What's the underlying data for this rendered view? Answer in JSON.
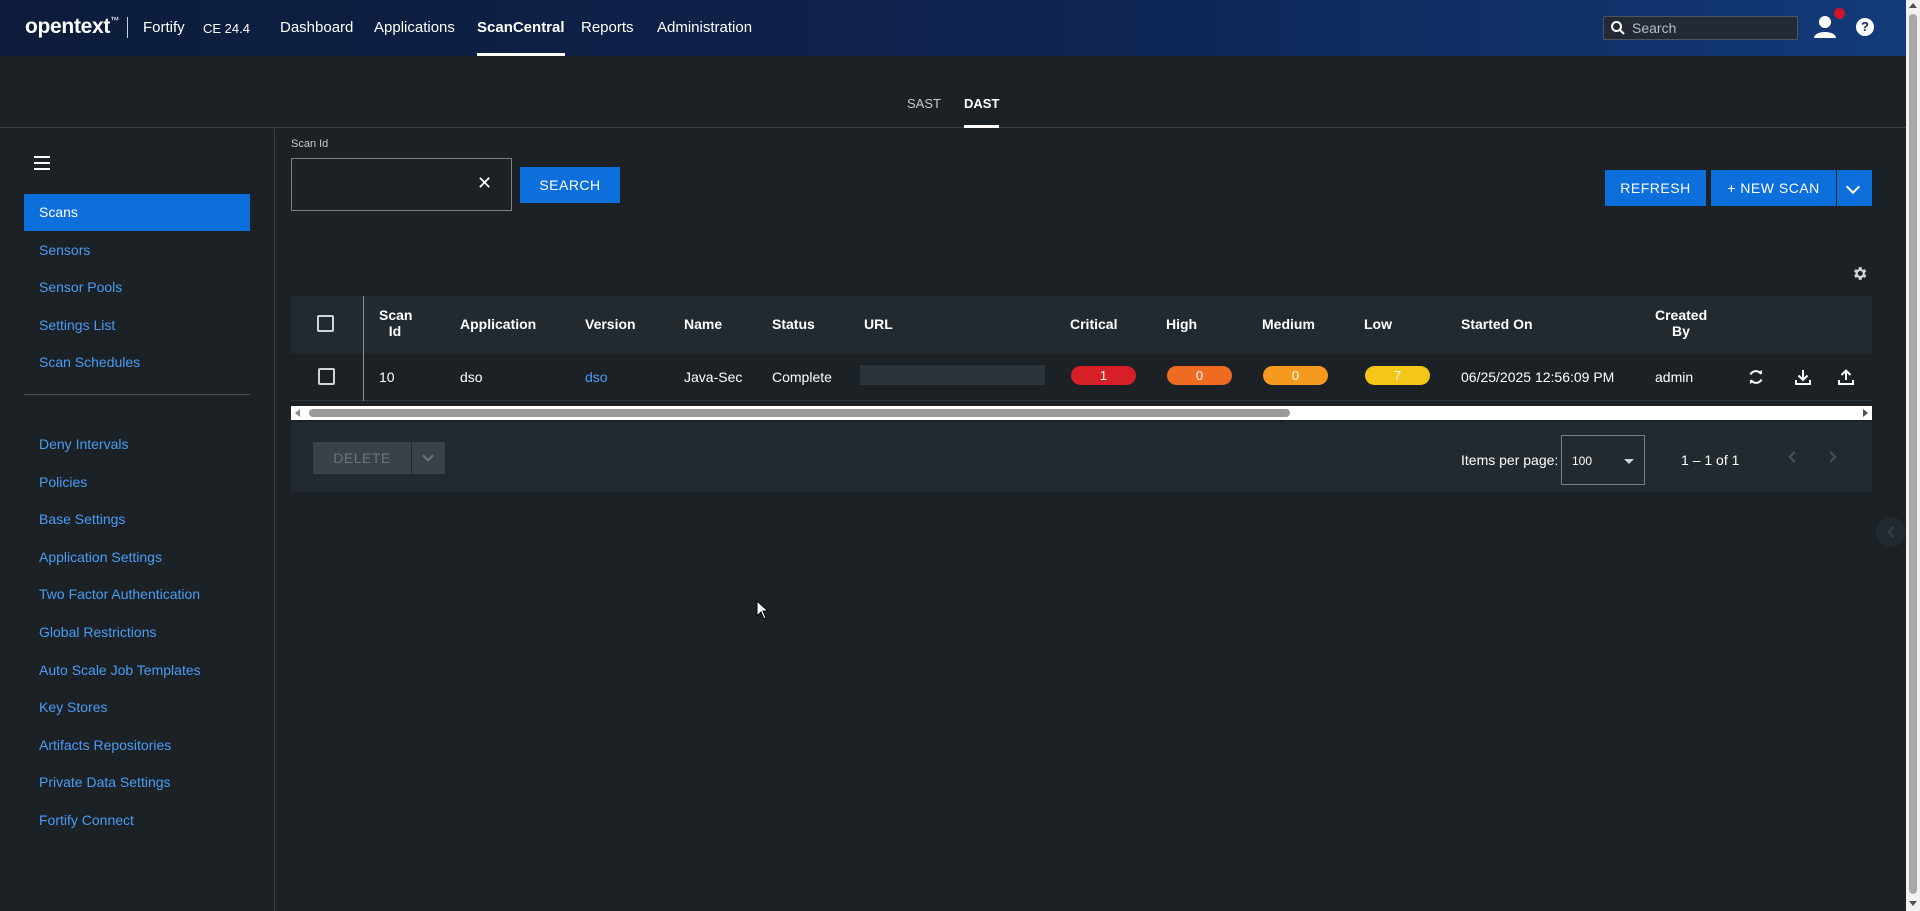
{
  "topnav": {
    "logo": "opentext",
    "logo_tm": "™",
    "product": "Fortify",
    "version": "CE 24.4",
    "items": [
      {
        "label": "Dashboard"
      },
      {
        "label": "Applications"
      },
      {
        "label": "ScanCentral",
        "active": true
      },
      {
        "label": "Reports"
      },
      {
        "label": "Administration"
      }
    ],
    "search_placeholder": "Search",
    "help_label": "?"
  },
  "tabs": [
    {
      "label": "SAST"
    },
    {
      "label": "DAST",
      "active": true
    }
  ],
  "sidebar": {
    "items": [
      {
        "label": "Scans",
        "active": true
      },
      {
        "label": "Sensors"
      },
      {
        "label": "Sensor Pools"
      },
      {
        "label": "Settings List"
      },
      {
        "label": "Scan Schedules"
      },
      {
        "label": "Deny Intervals"
      },
      {
        "label": "Policies"
      },
      {
        "label": "Base Settings"
      },
      {
        "label": "Application Settings"
      },
      {
        "label": "Two Factor Authentication"
      },
      {
        "label": "Global Restrictions"
      },
      {
        "label": "Auto Scale Job Templates"
      },
      {
        "label": "Key Stores"
      },
      {
        "label": "Artifacts Repositories"
      },
      {
        "label": "Private Data Settings"
      },
      {
        "label": "Fortify Connect"
      }
    ]
  },
  "filter": {
    "scan_id_label": "Scan Id",
    "scan_id_value": "",
    "search_button": "SEARCH"
  },
  "actions": {
    "refresh": "REFRESH",
    "new_scan": "+ NEW SCAN"
  },
  "table": {
    "columns": {
      "scan_id_1": "Scan",
      "scan_id_2": "Id",
      "application": "Application",
      "version": "Version",
      "name": "Name",
      "status": "Status",
      "url": "URL",
      "critical": "Critical",
      "high": "High",
      "medium": "Medium",
      "low": "Low",
      "started_on": "Started On",
      "created_by_1": "Created",
      "created_by_2": "By"
    },
    "rows": [
      {
        "scan_id": "10",
        "application": "dso",
        "version": "dso",
        "name": "Java-Sec",
        "status": "Complete",
        "url": "",
        "critical": "1",
        "high": "0",
        "medium": "0",
        "low": "7",
        "started_on": "06/25/2025 12:56:09 PM",
        "created_by": "admin"
      }
    ]
  },
  "colors": {
    "critical": "#d71f28",
    "high": "#f06b22",
    "medium": "#f59a1f",
    "low": "#f5c518",
    "accent": "#0c6fdb"
  },
  "footer": {
    "delete": "DELETE",
    "items_per_page_label": "Items per page:",
    "items_per_page": "100",
    "range": "1 – 1 of 1"
  }
}
